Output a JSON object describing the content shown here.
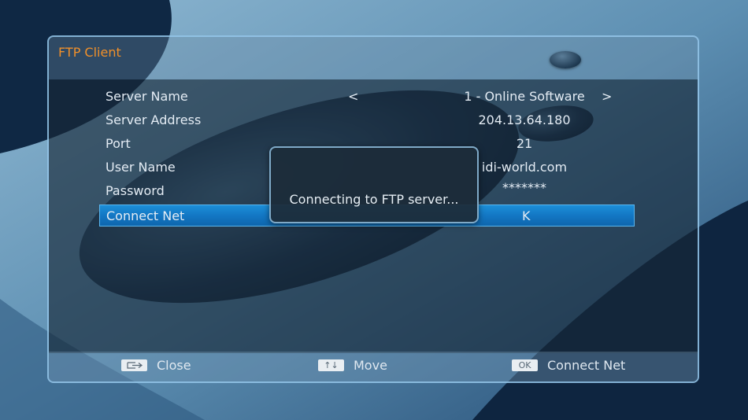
{
  "window": {
    "title": "FTP Client"
  },
  "fields": [
    {
      "label": "Server Name",
      "value": "1 - Online Software",
      "left_arrow": "<",
      "right_arrow": ">"
    },
    {
      "label": "Server Address",
      "value": "204.13.64.180"
    },
    {
      "label": "Port",
      "value": "21"
    },
    {
      "label": "User Name",
      "value": "idi-world.com"
    },
    {
      "label": "Password",
      "value": "*******"
    },
    {
      "label": "Connect Net",
      "value": "K"
    }
  ],
  "dialog": {
    "message": "Connecting to FTP server..."
  },
  "footer": [
    {
      "key": "exit-key",
      "label": "Close"
    },
    {
      "key": "↑↓",
      "label": "Move"
    },
    {
      "key": "OK",
      "label": "Connect Net"
    }
  ],
  "colors": {
    "title": "#f0902a",
    "selection": "#1377c4",
    "border": "#96c8eb"
  }
}
